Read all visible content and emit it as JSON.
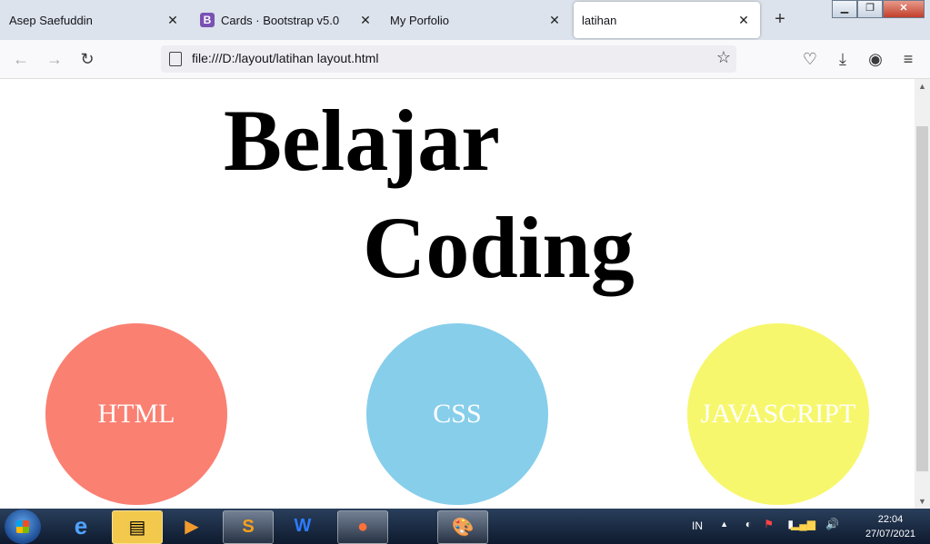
{
  "browser": {
    "tabs": [
      {
        "label": "Asep Saefuddin",
        "active": false
      },
      {
        "label": "Cards · Bootstrap v5.0",
        "active": false,
        "favicon_letter": "B"
      },
      {
        "label": "My Porfolio",
        "active": false
      },
      {
        "label": "latihan",
        "active": true
      }
    ],
    "new_tab_label": "+",
    "url": "file:///D:/layout/latihan layout.html"
  },
  "page": {
    "heading_line1": "Belajar",
    "heading_line2": "Coding",
    "circles": [
      {
        "label": "HTML",
        "color": "#fa8072"
      },
      {
        "label": "CSS",
        "color": "#87ceeb"
      },
      {
        "label": "JAVASCRIPT",
        "color": "#f7f76e"
      }
    ]
  },
  "taskbar": {
    "language": "IN",
    "time": "22:04",
    "date": "27/07/2021"
  }
}
